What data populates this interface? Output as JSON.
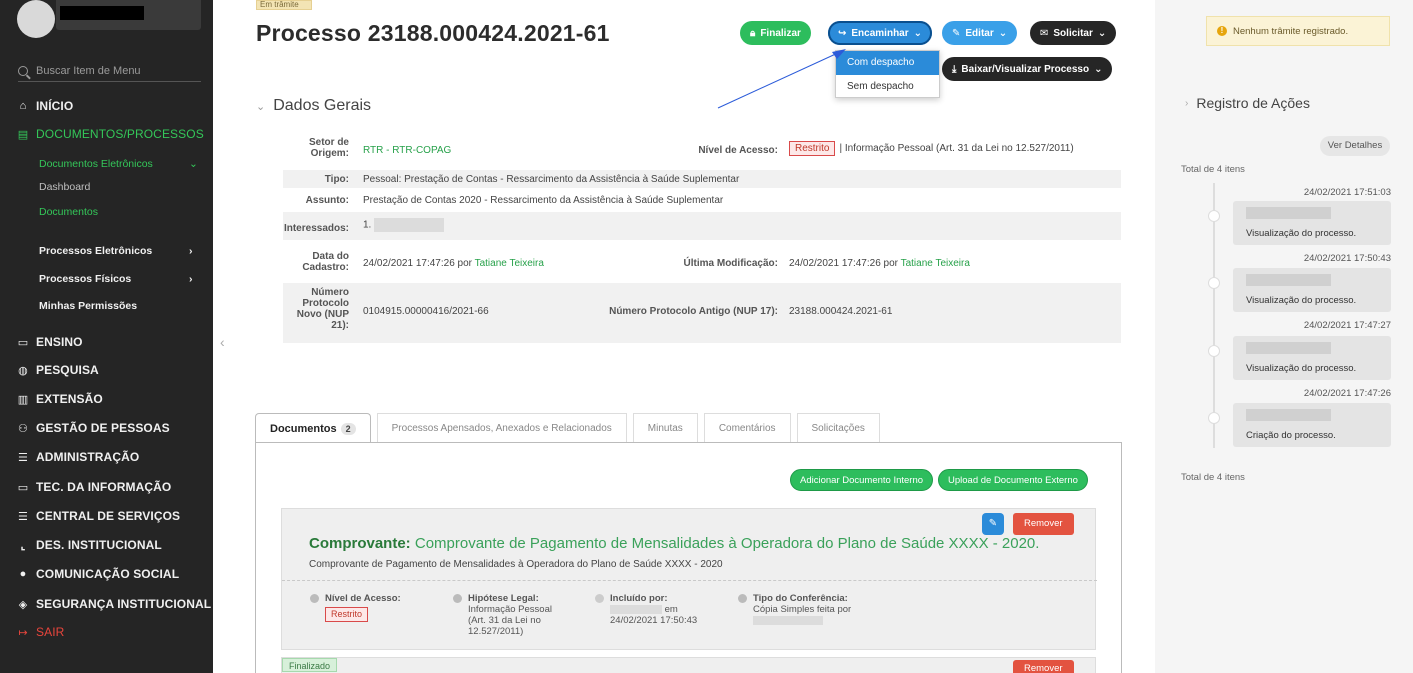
{
  "sidebar": {
    "search_placeholder": "Buscar Item de Menu",
    "items": [
      {
        "label": "INÍCIO",
        "icon": "home-icon",
        "glyph": "⌂"
      },
      {
        "label": "DOCUMENTOS/PROCESSOS",
        "icon": "document-icon",
        "glyph": "▤"
      },
      {
        "label": "ENSINO",
        "icon": "ensino-icon",
        "glyph": "▭"
      },
      {
        "label": "PESQUISA",
        "icon": "globe-icon",
        "glyph": "◍"
      },
      {
        "label": "EXTENSÃO",
        "icon": "chart-icon",
        "glyph": "▥"
      },
      {
        "label": "GESTÃO DE PESSOAS",
        "icon": "people-icon",
        "glyph": "⚇"
      },
      {
        "label": "ADMINISTRAÇÃO",
        "icon": "list-icon",
        "glyph": "☰"
      },
      {
        "label": "TEC. DA INFORMAÇÃO",
        "icon": "monitor-icon",
        "glyph": "▭"
      },
      {
        "label": "CENTRAL DE SERVIÇOS",
        "icon": "menu-icon",
        "glyph": "☰"
      },
      {
        "label": "DES. INSTITUCIONAL",
        "icon": "chart-line-icon",
        "glyph": "⌞"
      },
      {
        "label": "COMUNICAÇÃO SOCIAL",
        "icon": "chat-icon",
        "glyph": "●"
      },
      {
        "label": "SEGURANÇA INSTITUCIONAL",
        "icon": "shield-icon",
        "glyph": "◈"
      },
      {
        "label": "SAIR",
        "icon": "logout-icon",
        "glyph": "↦"
      }
    ],
    "subitems": [
      {
        "label": "Documentos Eletrônicos"
      },
      {
        "label": "Dashboard"
      },
      {
        "label": "Documentos"
      },
      {
        "label": "Processos Eletrônicos"
      },
      {
        "label": "Processos Físicos"
      },
      {
        "label": "Minhas Permissões"
      }
    ]
  },
  "header": {
    "status": "Em trâmite",
    "title": "Processo 23188.000424.2021-61",
    "buttons": {
      "finalizar": "Finalizar",
      "encaminhar": "Encaminhar",
      "editar": "Editar",
      "solicitar": "Solicitar",
      "baixar": "Baixar/Visualizar Processo"
    },
    "dropdown": [
      "Com despacho",
      "Sem despacho"
    ]
  },
  "dados": {
    "title": "Dados Gerais",
    "setor_label": "Setor de Origem:",
    "setor_value": "RTR - RTR-COPAG",
    "nivel_label": "Nível de Acesso:",
    "nivel_badge": "Restrito",
    "nivel_value": "| Informação Pessoal (Art. 31 da Lei no 12.527/2011)",
    "tipo_label": "Tipo:",
    "tipo_value": "Pessoal: Prestação de Contas - Ressarcimento da Assistência à Saúde Suplementar",
    "assunto_label": "Assunto:",
    "assunto_value": "Prestação de Contas 2020 - Ressarcimento da Assistência à Saúde Suplementar",
    "interessados_label": "Interessados:",
    "interessados_value": "1.",
    "data_label": "Data do Cadastro:",
    "data_value": "24/02/2021 17:47:26 por",
    "data_user": "Tatiane Teixeira",
    "ultima_label": "Última Modificação:",
    "ultima_value": "24/02/2021 17:47:26 por",
    "ultima_user": "Tatiane Teixeira",
    "protocolo_label": "Número Protocolo Novo (NUP 21):",
    "protocolo_value": "0104915.00000416/2021-66",
    "antigo_label": "Número Protocolo Antigo (NUP 17):",
    "antigo_value": "23188.000424.2021-61"
  },
  "tabs": [
    {
      "label": "Documentos",
      "count": "2"
    },
    {
      "label": "Processos Apensados, Anexados e Relacionados"
    },
    {
      "label": "Minutas"
    },
    {
      "label": "Comentários"
    },
    {
      "label": "Solicitações"
    }
  ],
  "documents": {
    "add_interno": "Adicionar Documento Interno",
    "upload_externo": "Upload de Documento Externo",
    "remove_label": "Remover",
    "edit_glyph": "✎",
    "card": {
      "title_bold": "Comprovante:",
      "title_rest": "Comprovante de Pagamento de Mensalidades à Operadora do Plano de Saúde XXXX - 2020.",
      "subtitle": "Comprovante de Pagamento de Mensalidades à Operadora do Plano de Saúde XXXX - 2020",
      "nivel_h": "Nível de Acesso:",
      "nivel_badge": "Restrito",
      "hipotese_h": "Hipótese Legal:",
      "hipotese_1": "Informação Pessoal",
      "hipotese_2": "(Art. 31 da Lei no",
      "hipotese_3": "12.527/2011)",
      "incluido_h": "Incluído por:",
      "incluido_em": "em",
      "incluido_data": "24/02/2021 17:50:43",
      "tipo_h": "Tipo do Conferência:",
      "tipo_1": "Cópia Simples feita por"
    },
    "card2_status": "Finalizado"
  },
  "right": {
    "notice": "Nenhum trâmite registrado.",
    "title": "Registro de Ações",
    "ver_detalhes": "Ver Detalhes",
    "total_top": "Total de 4 itens",
    "total_bottom": "Total de 4 itens",
    "events": [
      {
        "time": "24/02/2021 17:51:03",
        "text": "Visualização do processo."
      },
      {
        "time": "24/02/2021 17:50:43",
        "text": "Visualização do processo."
      },
      {
        "time": "24/02/2021 17:47:27",
        "text": "Visualização do processo."
      },
      {
        "time": "24/02/2021 17:47:26",
        "text": "Criação do processo."
      }
    ]
  },
  "colors": {
    "sidebar_bg": "#252525",
    "green": "#2dbd5d",
    "blue": "#2b8bd9",
    "dark": "#262626",
    "red": "#e35340"
  }
}
